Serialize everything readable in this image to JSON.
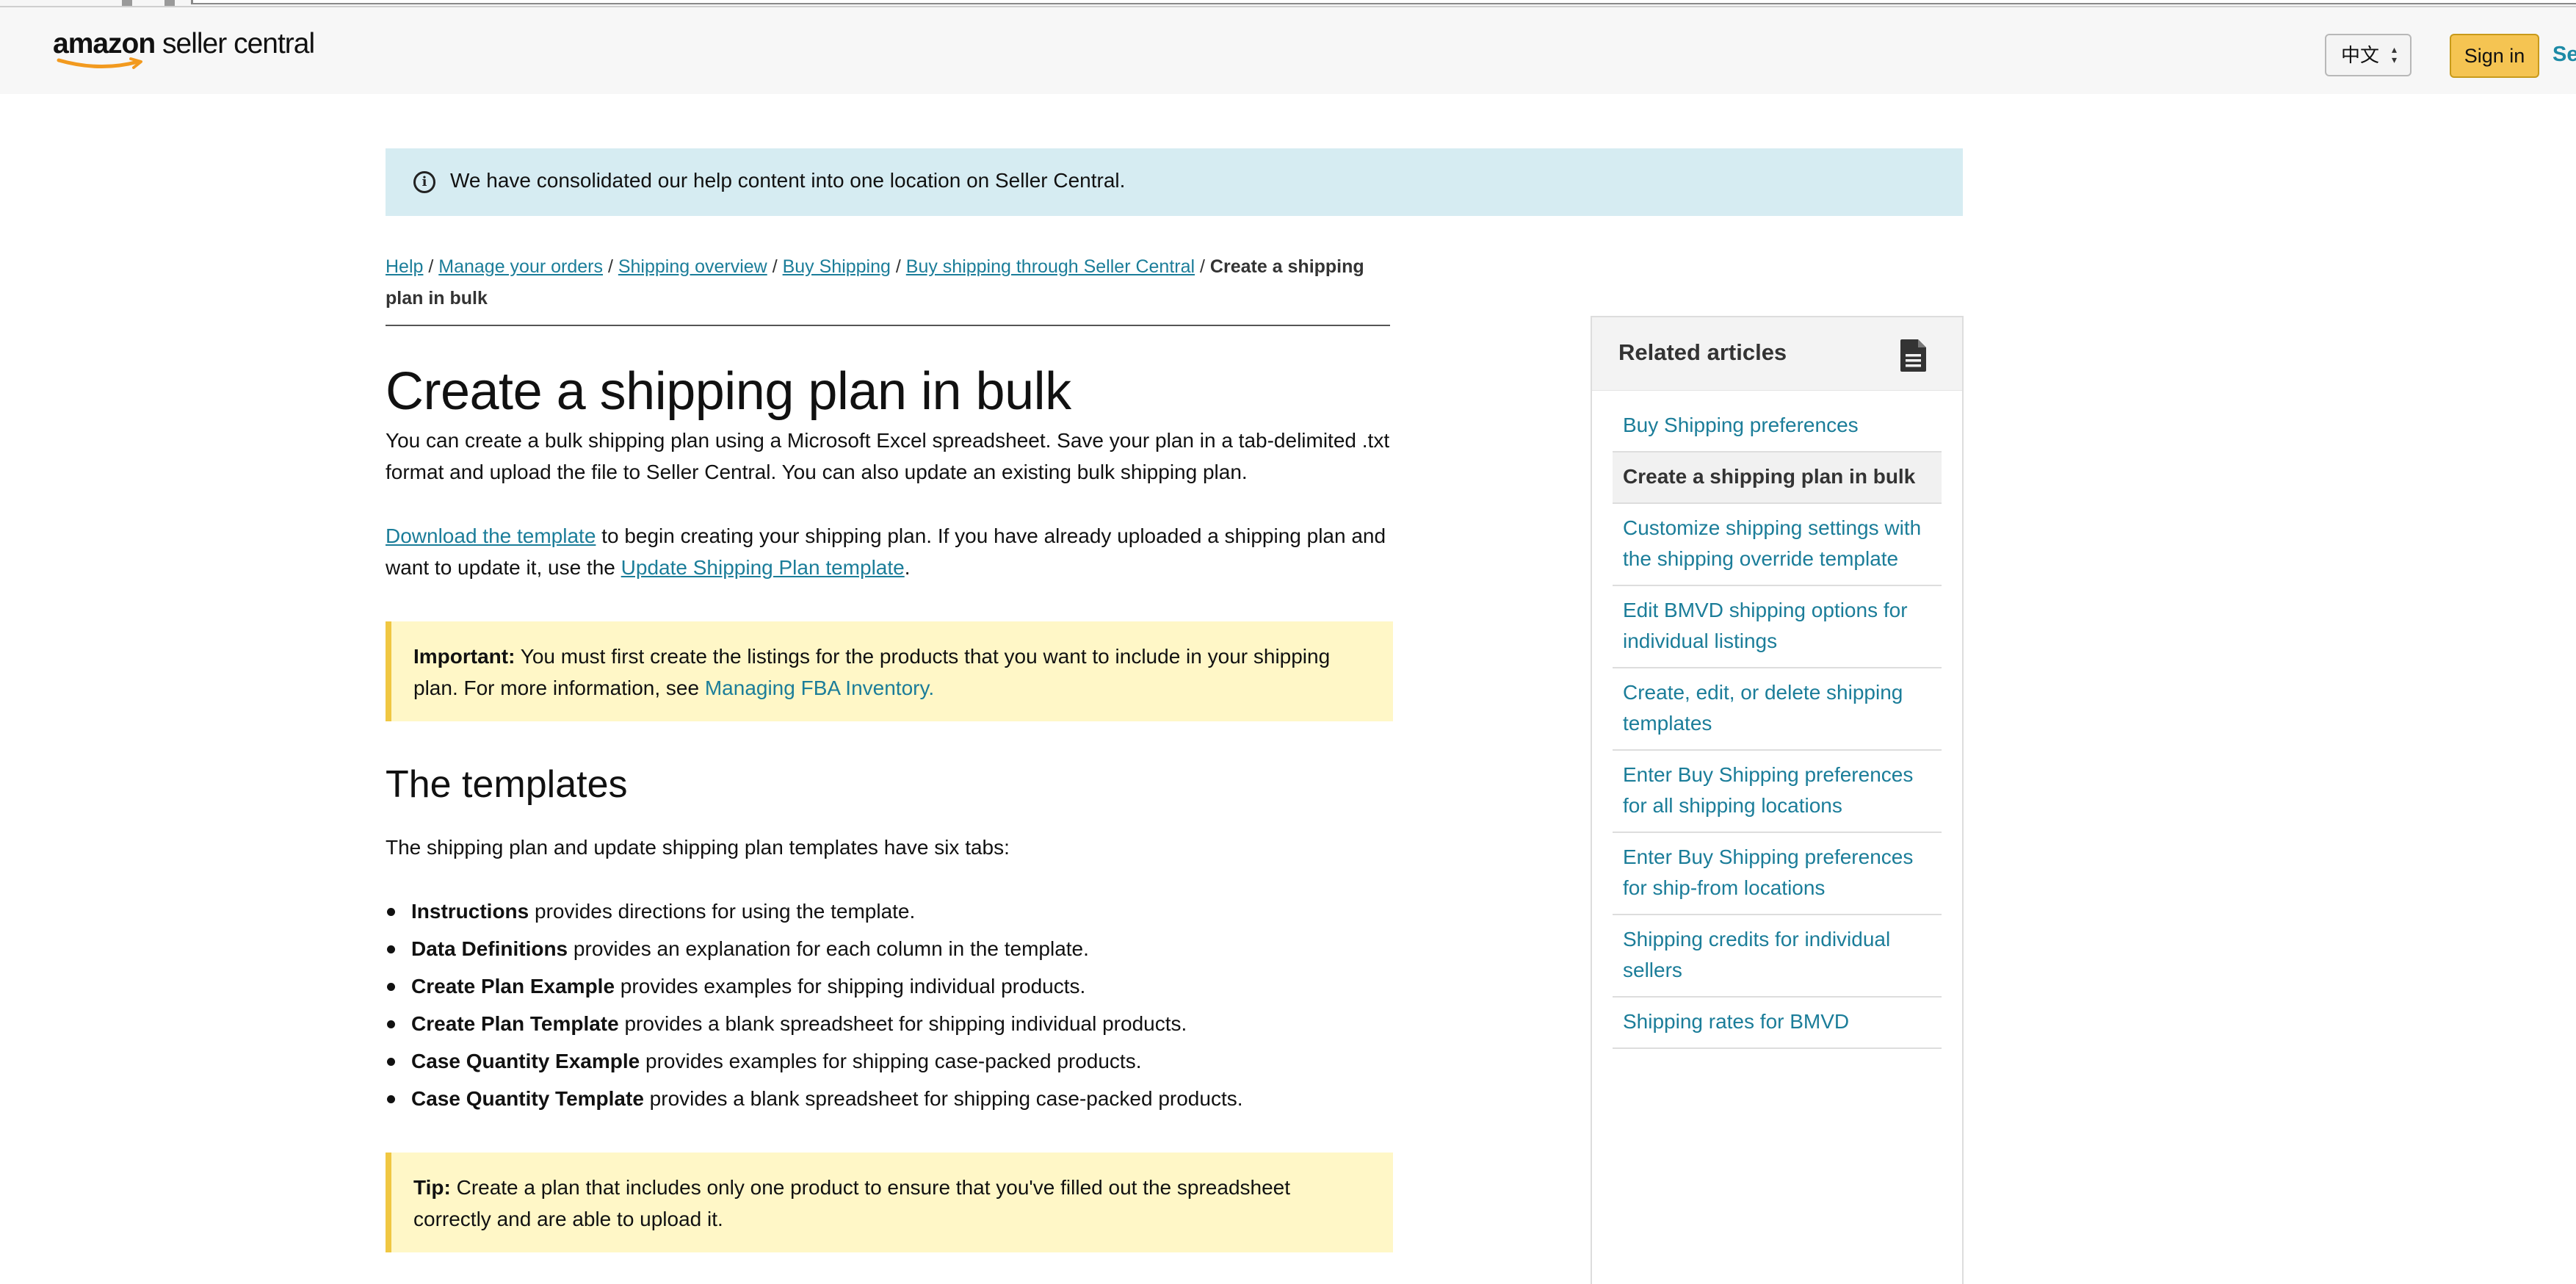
{
  "header": {
    "logo_bold": "amazon",
    "logo_rest": " seller central",
    "language": "中文",
    "sign_in": "Sign in",
    "cut_link": "Se"
  },
  "banner": {
    "text": "We have consolidated our help content into one location on Seller Central."
  },
  "breadcrumb": {
    "items": [
      "Help",
      "Manage your orders",
      "Shipping overview",
      "Buy Shipping",
      "Buy shipping through Seller Central"
    ],
    "separator": " / ",
    "current": "Create a shipping plan in bulk"
  },
  "article": {
    "title": "Create a shipping plan in bulk",
    "intro": "You can create a bulk shipping plan using a Microsoft Excel spreadsheet. Save your plan in a tab-delimited .txt format and upload the file to Seller Central. You can also update an existing bulk shipping plan.",
    "download_link": "Download the template",
    "download_rest": " to begin creating your shipping plan. If you have already uploaded a shipping plan and want to update it, use the ",
    "update_link": "Update Shipping Plan template",
    "update_end": ".",
    "important_label": "Important:",
    "important_text": " You must first create the listings for the products that you want to include in your shipping plan. For more information, see ",
    "important_link": "Managing FBA Inventory.",
    "templates_heading": "The templates",
    "templates_intro": "The shipping plan and update shipping plan templates have six tabs:",
    "tabs": [
      {
        "name": "Instructions",
        "desc": " provides directions for using the template."
      },
      {
        "name": "Data Definitions",
        "desc": " provides an explanation for each column in the template."
      },
      {
        "name": "Create Plan Example",
        "desc": " provides examples for shipping individual products."
      },
      {
        "name": "Create Plan Template",
        "desc": " provides a blank spreadsheet for shipping individual products."
      },
      {
        "name": "Case Quantity Example",
        "desc": " provides examples for shipping case-packed products."
      },
      {
        "name": "Case Quantity Template",
        "desc": " provides a blank spreadsheet for shipping case-packed products."
      }
    ],
    "tip_label": "Tip:",
    "tip_text": " Create a plan that includes only one product to ensure that you've filled out the spreadsheet correctly and are able to upload it."
  },
  "sidebar": {
    "title": "Related articles",
    "icon": "document-icon",
    "items": [
      {
        "label": "Buy Shipping preferences",
        "current": false
      },
      {
        "label": "Create a shipping plan in bulk",
        "current": true
      },
      {
        "label": "Customize shipping settings with the shipping override template",
        "current": false
      },
      {
        "label": "Edit BMVD shipping options for individual listings",
        "current": false
      },
      {
        "label": "Create, edit, or delete shipping templates",
        "current": false
      },
      {
        "label": "Enter Buy Shipping preferences for all shipping locations",
        "current": false
      },
      {
        "label": "Enter Buy Shipping preferences for ship-from locations",
        "current": false
      },
      {
        "label": "Shipping credits for individual sellers",
        "current": false
      },
      {
        "label": "Shipping rates for BMVD",
        "current": false
      }
    ]
  },
  "colors": {
    "link": "#1b7d99",
    "banner_bg": "#d6ecf2",
    "callout_bg": "#fff7c7",
    "callout_border": "#f0c742",
    "sign_in_bg": "#f5c452"
  }
}
